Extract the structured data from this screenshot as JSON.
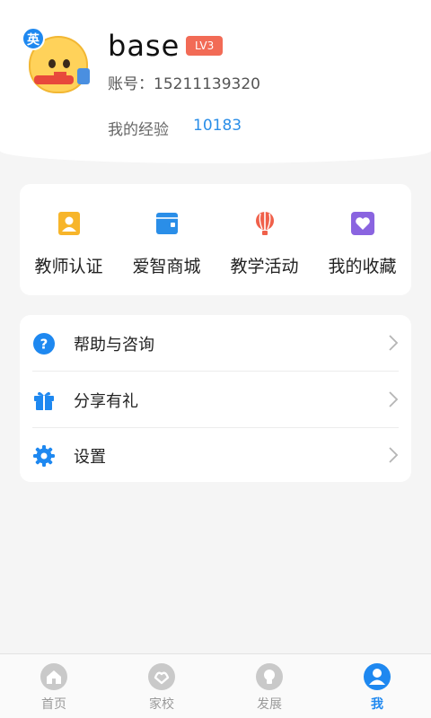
{
  "profile": {
    "subject_badge": "英",
    "username": "base",
    "level": "LV3",
    "account_label": "账号：",
    "account_number": "15211139320",
    "exp_label": "我的经验",
    "exp_value": "10183"
  },
  "quick_actions": [
    {
      "label": "教师认证",
      "icon": "teacher-certification-icon",
      "color": "#f7b52a"
    },
    {
      "label": "爱智商城",
      "icon": "wallet-shop-icon",
      "color": "#2a8ee8"
    },
    {
      "label": "教学活动",
      "icon": "balloon-icon",
      "color": "#f0604a"
    },
    {
      "label": "我的收藏",
      "icon": "heart-favorite-icon",
      "color": "#8a64e0"
    }
  ],
  "menu": [
    {
      "label": "帮助与咨询",
      "icon": "question-icon"
    },
    {
      "label": "分享有礼",
      "icon": "gift-icon"
    },
    {
      "label": "设置",
      "icon": "gear-icon"
    }
  ],
  "tabs": [
    {
      "label": "首页",
      "icon": "home-icon",
      "active": false
    },
    {
      "label": "家校",
      "icon": "home-school-icon",
      "active": false
    },
    {
      "label": "发展",
      "icon": "lightbulb-icon",
      "active": false
    },
    {
      "label": "我",
      "icon": "user-icon",
      "active": true
    }
  ],
  "colors": {
    "accent": "#1e88f0",
    "level_badge": "#f26b56",
    "exp_value": "#2a8ee8",
    "background": "#f5f5f5"
  }
}
